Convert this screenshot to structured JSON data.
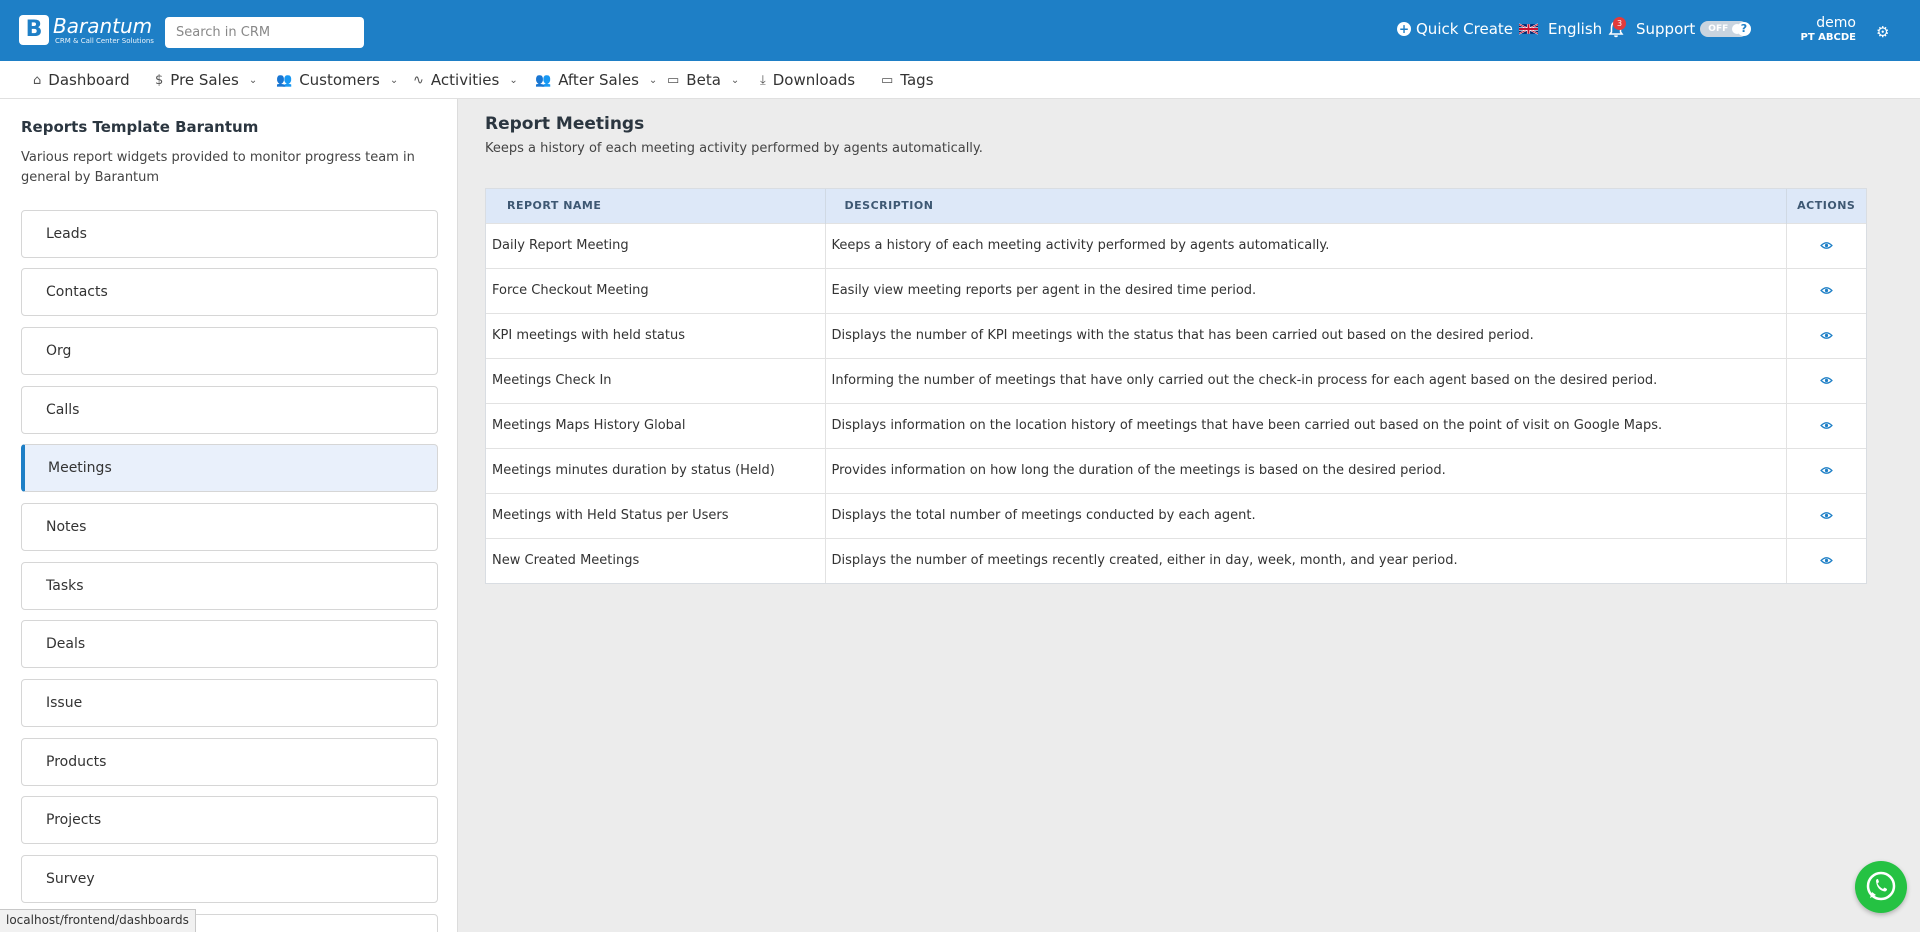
{
  "header": {
    "logo_name": "Barantum",
    "logo_tagline": "CRM & Call Center Solutions",
    "search_placeholder": "Search in CRM",
    "quick_create": "Quick Create",
    "language": "English",
    "notification_count": "3",
    "support": "Support",
    "support_toggle": "OFF",
    "user_name": "demo",
    "user_org": "PT ABCDE"
  },
  "nav": {
    "items": [
      {
        "label": "Dashboard",
        "icon": "home-icon"
      },
      {
        "label": "Pre Sales",
        "icon": "dollar-icon",
        "dropdown": true
      },
      {
        "label": "Customers",
        "icon": "users-icon",
        "dropdown": true
      },
      {
        "label": "Activities",
        "icon": "activity-icon",
        "dropdown": true
      },
      {
        "label": "After Sales",
        "icon": "users-icon",
        "dropdown": true
      },
      {
        "label": "Beta",
        "icon": "folder-icon",
        "dropdown": true
      },
      {
        "label": "Downloads",
        "icon": "download-icon"
      },
      {
        "label": "Tags",
        "icon": "folder-icon"
      }
    ]
  },
  "sidebar": {
    "title": "Reports Template Barantum",
    "description": "Various report widgets provided to monitor progress team in general by Barantum",
    "items": [
      {
        "label": "Leads"
      },
      {
        "label": "Contacts"
      },
      {
        "label": "Org"
      },
      {
        "label": "Calls"
      },
      {
        "label": "Meetings",
        "active": true
      },
      {
        "label": "Notes"
      },
      {
        "label": "Tasks"
      },
      {
        "label": "Deals"
      },
      {
        "label": "Issue"
      },
      {
        "label": "Products"
      },
      {
        "label": "Projects"
      },
      {
        "label": "Survey"
      }
    ]
  },
  "main": {
    "title": "Report Meetings",
    "description": "Keeps a history of each meeting activity performed by agents automatically.",
    "columns": [
      "REPORT NAME",
      "DESCRIPTION",
      "ACTIONS"
    ],
    "rows": [
      {
        "name": "Daily Report Meeting",
        "description": "Keeps a history of each meeting activity performed by agents automatically."
      },
      {
        "name": "Force Checkout Meeting",
        "description": "Easily view meeting reports per agent in the desired time period."
      },
      {
        "name": "KPI meetings with held status",
        "description": "Displays the number of KPI meetings with the status that has been carried out based on the desired period."
      },
      {
        "name": "Meetings Check In",
        "description": "Informing the number of meetings that have only carried out the check-in process for each agent based on the desired period."
      },
      {
        "name": "Meetings Maps History Global",
        "description": "Displays information on the location history of meetings that have been carried out based on the point of visit on Google Maps."
      },
      {
        "name": "Meetings minutes duration by status (Held)",
        "description": "Provides information on how long the duration of the meetings is based on the desired period."
      },
      {
        "name": "Meetings with Held Status per Users",
        "description": "Displays the total number of meetings conducted by each agent."
      },
      {
        "name": "New Created Meetings",
        "description": "Displays the number of meetings recently created, either in day, week, month, and year period."
      }
    ]
  },
  "status_bar": {
    "url": "localhost/frontend/dashboards"
  },
  "colors": {
    "brand": "#1e7fc6",
    "header_row": "#dde8f8",
    "active_item": "#e9f0fb",
    "whatsapp": "#25c243"
  }
}
